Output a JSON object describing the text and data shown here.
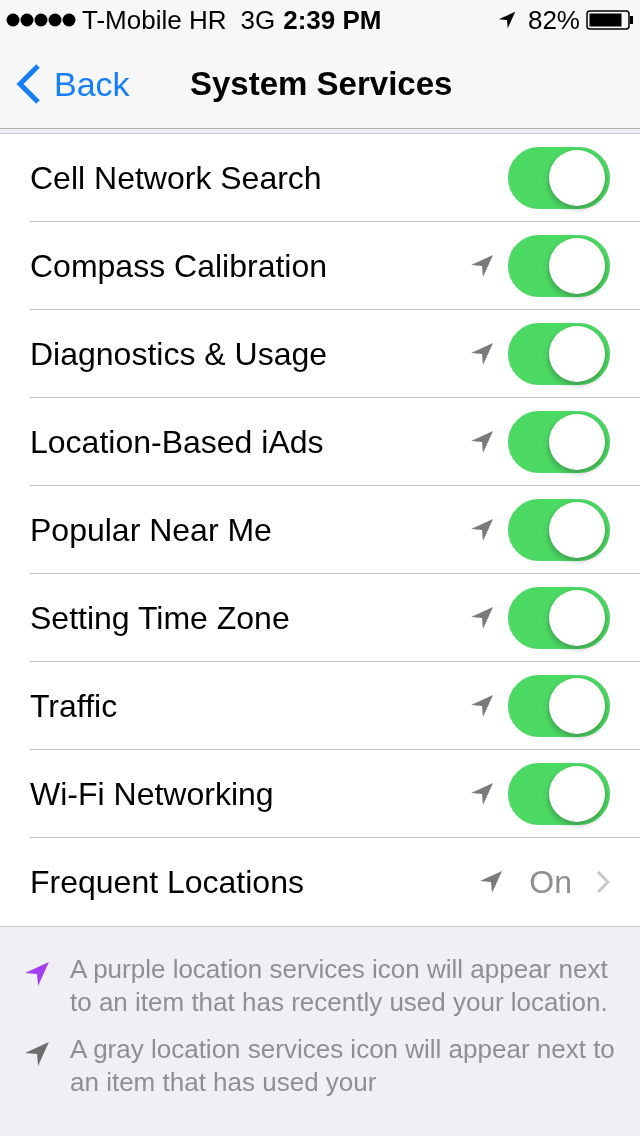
{
  "status_bar": {
    "carrier": "T-Mobile HR",
    "network": "3G",
    "time": "2:39 PM",
    "battery": "82%"
  },
  "nav": {
    "back": "Back",
    "title": "System Services"
  },
  "rows": [
    {
      "kind": "switch",
      "label": "Cell Network Search",
      "location_icon": false,
      "on": true
    },
    {
      "kind": "switch",
      "label": "Compass Calibration",
      "location_icon": true,
      "on": true
    },
    {
      "kind": "switch",
      "label": "Diagnostics & Usage",
      "location_icon": true,
      "on": true
    },
    {
      "kind": "switch",
      "label": "Location-Based iAds",
      "location_icon": true,
      "on": true
    },
    {
      "kind": "switch",
      "label": "Popular Near Me",
      "location_icon": true,
      "on": true
    },
    {
      "kind": "switch",
      "label": "Setting Time Zone",
      "location_icon": true,
      "on": true
    },
    {
      "kind": "switch",
      "label": "Traffic",
      "location_icon": true,
      "on": true
    },
    {
      "kind": "switch",
      "label": "Wi-Fi Networking",
      "location_icon": true,
      "on": true
    },
    {
      "kind": "disclosure",
      "label": "Frequent Locations",
      "location_icon": true,
      "value": "On"
    }
  ],
  "notes": [
    {
      "color": "#a23ff2",
      "text": "A purple location services icon will appear next to an item that has recently used your location."
    },
    {
      "color": "#6e6e6e",
      "text": "A gray location services icon will appear next to an item that has used your"
    }
  ]
}
